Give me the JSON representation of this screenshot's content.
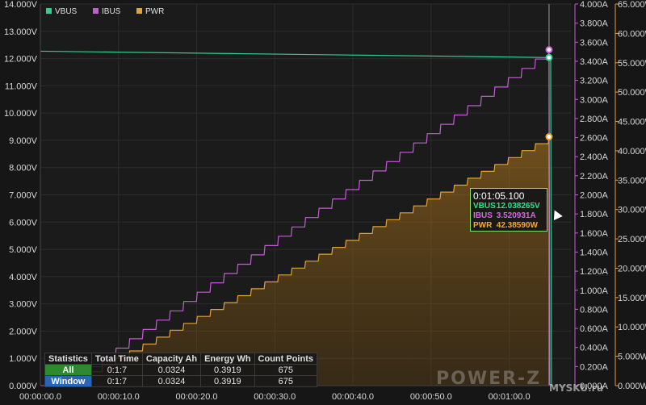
{
  "chart_data": {
    "type": "line",
    "x_axis": {
      "ticks": [
        "00:00:00.0",
        "00:00:10.0",
        "00:00:20.0",
        "00:00:30.0",
        "00:00:40.0",
        "00:00:50.0",
        "00:01:00.0"
      ],
      "range_seconds": [
        0,
        68
      ]
    },
    "y_axis_left": {
      "ticks": [
        "0.000V",
        "1.000V",
        "2.000V",
        "3.000V",
        "4.000V",
        "5.000V",
        "6.000V",
        "7.000V",
        "8.000V",
        "9.000V",
        "10.000V",
        "11.000V",
        "12.000V",
        "13.000V",
        "14.000V"
      ],
      "range": [
        0,
        14
      ]
    },
    "y_axis_right1": {
      "ticks": [
        "0.000A",
        "0.200A",
        "0.400A",
        "0.600A",
        "0.800A",
        "1.000A",
        "1.200A",
        "1.400A",
        "1.600A",
        "1.800A",
        "2.000A",
        "2.200A",
        "2.400A",
        "2.600A",
        "2.800A",
        "3.000A",
        "3.200A",
        "3.400A",
        "3.600A",
        "3.800A",
        "4.000A"
      ],
      "range": [
        0,
        4
      ]
    },
    "y_axis_right2": {
      "ticks": [
        "0.000W",
        "5.000W",
        "10.000W",
        "15.000W",
        "20.000W",
        "25.000W",
        "30.000W",
        "35.000W",
        "40.000W",
        "45.000W",
        "50.000W",
        "55.000W",
        "60.000W",
        "65.000W"
      ],
      "range": [
        0,
        65
      ]
    },
    "legend": [
      "VBUS",
      "IBUS",
      "PWR"
    ],
    "legend_placement": "top-left",
    "grid": true,
    "series": [
      {
        "name": "VBUS",
        "color": "#2fcf8c",
        "axis": "left",
        "x": [
          0,
          65.1
        ],
        "values": [
          12.27,
          12.038
        ]
      },
      {
        "name": "IBUS",
        "color": "#c45cd6",
        "axis": "right1",
        "x_start": 4.5,
        "x_end": 65.1,
        "steps": 35,
        "values_start": 0.1,
        "values_end": 3.5209
      },
      {
        "name": "PWR",
        "color": "#e3a236",
        "axis": "right2",
        "x_start": 4.5,
        "x_end": 65.1,
        "steps": 35,
        "values_start": 1.2,
        "values_end": 42.3859
      }
    ],
    "cursor": {
      "x_seconds": 65.1
    }
  },
  "tooltip": {
    "time": "0:01:05.100",
    "vbus_label": "VBUS",
    "vbus_value": "12.038265V",
    "ibus_label": "IBUS",
    "ibus_value": "3.520931A",
    "pwr_label": "PWR",
    "pwr_value": "42.38590W"
  },
  "stats": {
    "headers": [
      "Statistics",
      "Total Time",
      "Capacity Ah",
      "Energy Wh",
      "Count Points"
    ],
    "rows": [
      {
        "label": "All",
        "total_time": "0:1:7",
        "capacity": "0.0324",
        "energy": "0.3919",
        "count": "675"
      },
      {
        "label": "Window",
        "total_time": "0:1:7",
        "capacity": "0.0324",
        "energy": "0.3919",
        "count": "675"
      }
    ]
  },
  "watermark": {
    "brand": "POWER-Z",
    "site": "MYSKU",
    "tld": ".ru"
  }
}
